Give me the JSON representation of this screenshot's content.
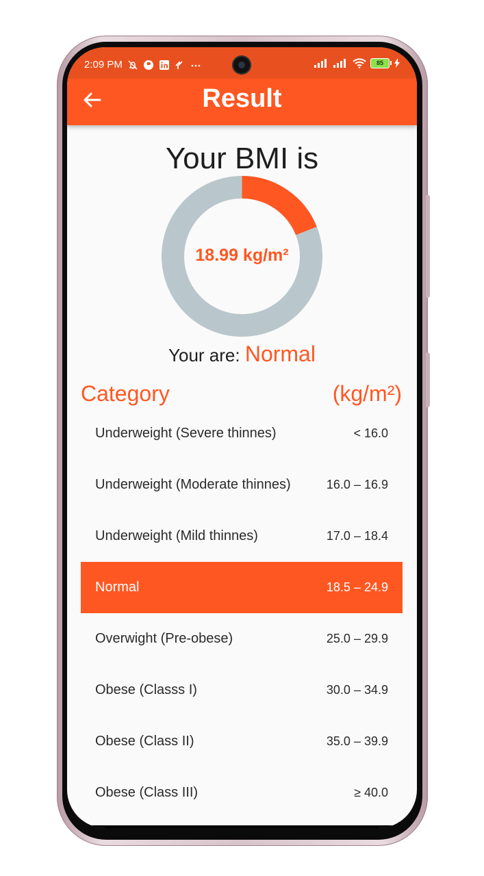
{
  "status_bar": {
    "time": "2:09 PM",
    "battery_level": "85"
  },
  "app_bar": {
    "title": "Result",
    "back_icon": "arrow-left-icon"
  },
  "result": {
    "heading": "Your BMI is",
    "bmi_value": "18.99 kg/m²",
    "bmi_number": 18.99,
    "gauge_fraction": 0.19,
    "you_are_label": "Your are: ",
    "category_label": "Normal"
  },
  "table": {
    "header_category": "Category",
    "header_unit": "(kg/m²)",
    "rows": [
      {
        "name": "Underweight (Severe thinnes)",
        "range": "< 16.0"
      },
      {
        "name": "Underweight (Moderate thinnes)",
        "range": "16.0 – 16.9"
      },
      {
        "name": "Underweight (Mild thinnes)",
        "range": "17.0 – 18.4"
      },
      {
        "name": "Normal",
        "range": "18.5 – 24.9"
      },
      {
        "name": "Overwight (Pre-obese)",
        "range": "25.0 – 29.9"
      },
      {
        "name": "Obese (Classs I)",
        "range": "30.0 – 34.9"
      },
      {
        "name": "Obese (Class II)",
        "range": "35.0 – 39.9"
      },
      {
        "name": "Obese (Class III)",
        "range": "≥ 40.0"
      }
    ],
    "active_index": 3
  },
  "colors": {
    "accent": "#ff5722",
    "ring_track": "#b9c7cc"
  }
}
